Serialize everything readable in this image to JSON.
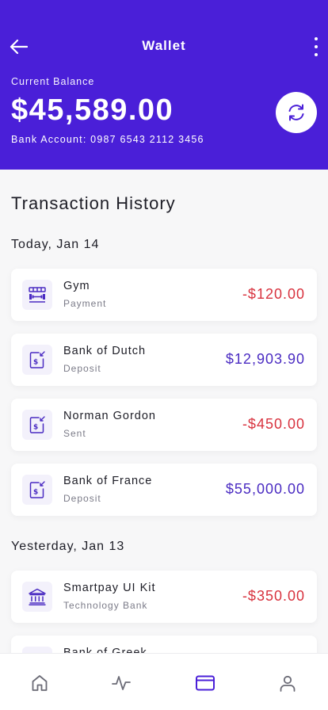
{
  "header": {
    "title": "Wallet",
    "balance_label": "Current Balance",
    "balance": "$45,589.00",
    "bank_account": "Bank Account: 0987 6543 2112 3456",
    "icons": {
      "back": "arrow-left-icon",
      "more": "more-vertical-icon",
      "refresh": "refresh-icon"
    }
  },
  "history": {
    "title": "Transaction History",
    "sections": [
      {
        "date": "Today, Jan 14",
        "items": [
          {
            "name": "Gym",
            "type": "Payment",
            "amount": "-$120.00",
            "icon": "gym-icon"
          },
          {
            "name": "Bank of Dutch",
            "type": "Deposit",
            "amount": "$12,903.90",
            "icon": "deposit-icon"
          },
          {
            "name": "Norman Gordon",
            "type": "Sent",
            "amount": "-$450.00",
            "icon": "deposit-icon"
          },
          {
            "name": "Bank of France",
            "type": "Deposit",
            "amount": "$55,000.00",
            "icon": "deposit-icon"
          }
        ]
      },
      {
        "date": "Yesterday, Jan 13",
        "items": [
          {
            "name": "Smartpay UI Kit",
            "type": "Technology Bank",
            "amount": "-$350.00",
            "icon": "bank-icon"
          },
          {
            "name": "Bank of Greek",
            "type": "",
            "amount": "",
            "icon": "deposit-icon"
          }
        ]
      }
    ]
  },
  "nav": {
    "items": [
      {
        "icon": "home-icon",
        "active": false
      },
      {
        "icon": "activity-icon",
        "active": false
      },
      {
        "icon": "wallet-card-icon",
        "active": true
      },
      {
        "icon": "profile-icon",
        "active": false
      }
    ]
  },
  "colors": {
    "primary": "#4a1fd8",
    "negative": "#d8323e",
    "positive": "#4a2bc2",
    "inactive_nav": "#6b6b76"
  }
}
